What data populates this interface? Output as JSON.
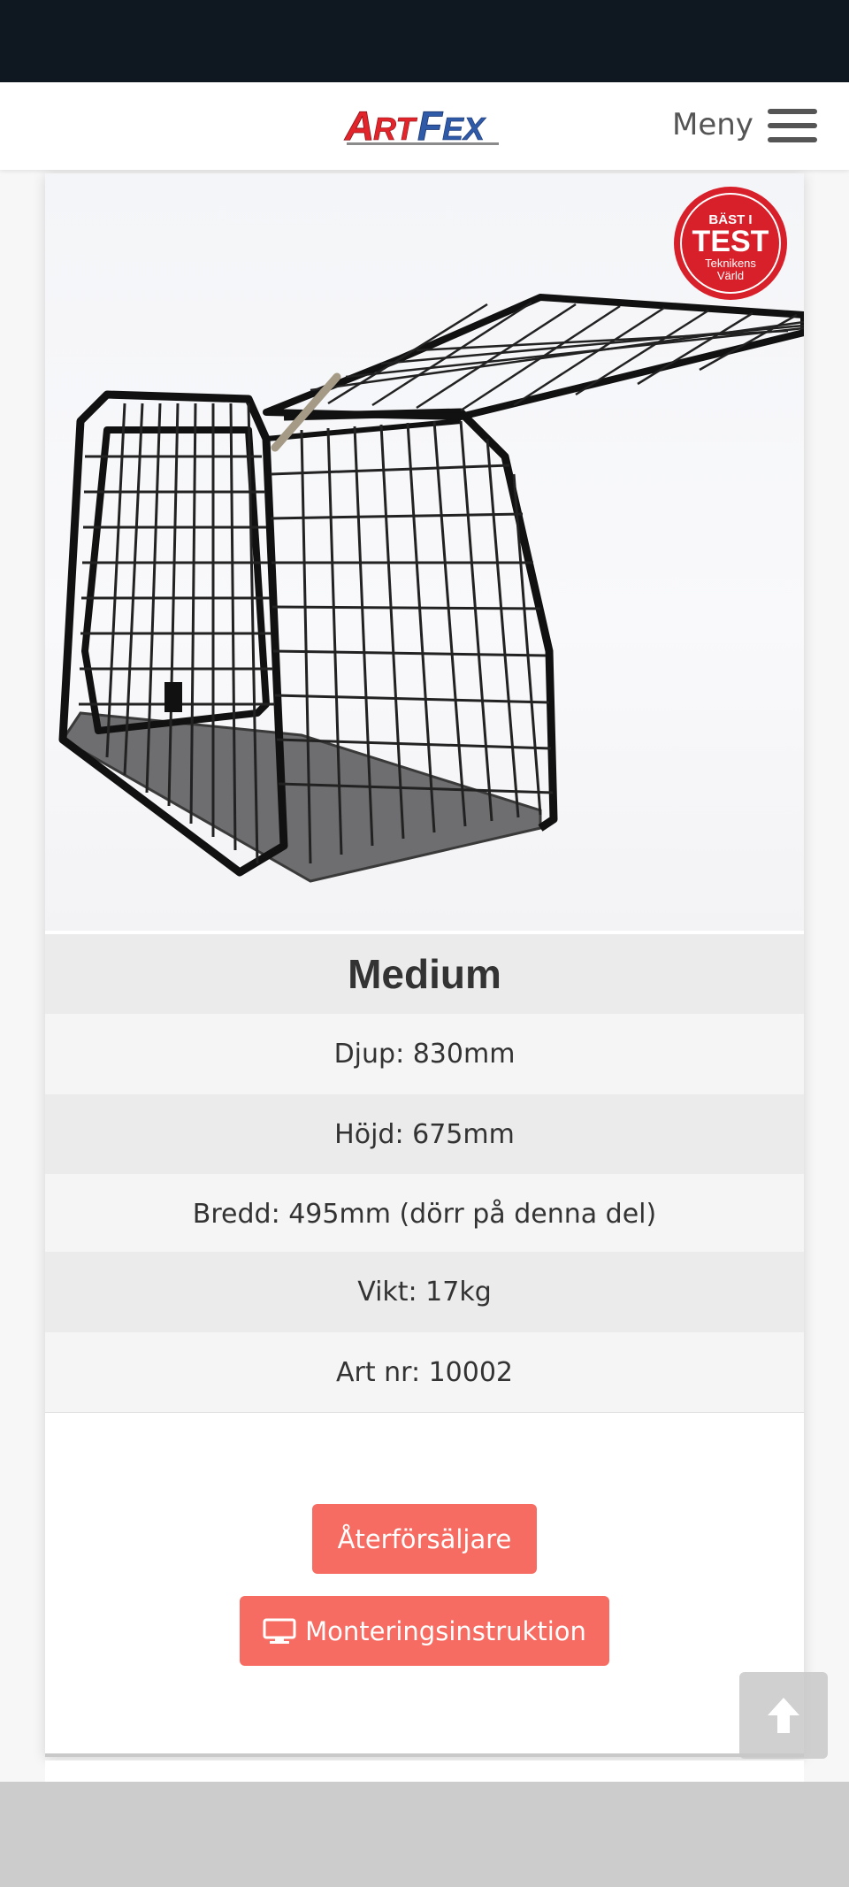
{
  "header": {
    "logo_text": "ARTFEX",
    "menu_label": "Meny"
  },
  "badge": {
    "line1": "BÄST I",
    "line2": "TEST",
    "line3": "Teknikens",
    "line4": "Värld"
  },
  "product": {
    "title": "Medium",
    "specs": [
      "Djup: 830mm",
      "Höjd: 675mm",
      "Bredd: 495mm (dörr på denna del)",
      "Vikt: 17kg",
      "Art nr: 10002"
    ]
  },
  "buttons": {
    "retailers_label": "Återförsäljare",
    "manual_label": "Monteringsinstruktion"
  },
  "icons": {
    "menu": "hamburger-icon",
    "manual": "monitor-icon",
    "scroll_top": "arrow-up-icon"
  },
  "colors": {
    "status_bar": "#0f1720",
    "accent_button": "#f66c62",
    "logo_red": "#e1252b",
    "logo_blue": "#2f5aa8",
    "badge_red": "#d8202a"
  }
}
